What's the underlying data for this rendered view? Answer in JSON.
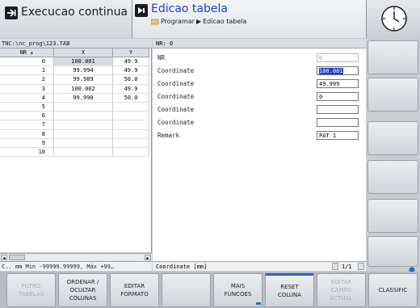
{
  "header": {
    "mode_title": "Execucao continua",
    "sub_title": "Edicao tabela",
    "breadcrumb_a": "Programar",
    "breadcrumb_b": "Edicao tabela",
    "accent": "#1f3fc8"
  },
  "table": {
    "path": "TNC:\\nc_prog\\123.TAB",
    "columns": [
      "NR",
      "X",
      "Y"
    ],
    "rows": [
      {
        "nr": "0",
        "x": "100.001",
        "y": "49.9"
      },
      {
        "nr": "1",
        "x": "99.994",
        "y": "49.9"
      },
      {
        "nr": "2",
        "x": "99.989",
        "y": "50.0"
      },
      {
        "nr": "3",
        "x": "100.002",
        "y": "49.9"
      },
      {
        "nr": "4",
        "x": "99.990",
        "y": "50.0"
      },
      {
        "nr": "5",
        "x": "",
        "y": ""
      },
      {
        "nr": "6",
        "x": "",
        "y": ""
      },
      {
        "nr": "7",
        "x": "",
        "y": ""
      },
      {
        "nr": "8",
        "x": "",
        "y": ""
      },
      {
        "nr": "9",
        "x": "",
        "y": ""
      },
      {
        "nr": "10",
        "x": "",
        "y": ""
      }
    ],
    "status": "C.. mm Min -99999.99999, Máx +99…"
  },
  "form": {
    "header": "NR: 0",
    "fields": [
      {
        "label": "NR",
        "value": "0"
      },
      {
        "label": "Coordinate",
        "value": "100.001"
      },
      {
        "label": "Coordinate",
        "value": "49.999"
      },
      {
        "label": "Coordinate",
        "value": "0"
      },
      {
        "label": "Coordinate",
        "value": ""
      },
      {
        "label": "Coordinate",
        "value": ""
      },
      {
        "label": "Remark",
        "value": "PAT 1"
      }
    ],
    "status": "Coordinate [mm]",
    "page": "1/1"
  },
  "softkeys": [
    {
      "label": "FILTRO\nTABELAS",
      "enabled": false
    },
    {
      "label": "ORDENAR /\nOCULTAR\nCOLUNAS",
      "enabled": true
    },
    {
      "label": "EDITAR\nFORMATO",
      "enabled": true
    },
    {
      "label": "",
      "enabled": true
    },
    {
      "label": "MAIS\nFUNCOES",
      "enabled": true
    },
    {
      "label": "RESET\nCOLUNA",
      "enabled": true
    },
    {
      "label": "EDITAR\nCAMPO\nACTUAL",
      "enabled": false
    },
    {
      "label": "CLASSIFIC",
      "enabled": true
    }
  ],
  "icons": {
    "mode": "program-run-icon",
    "edit": "table-edit-icon",
    "clock": "clock-icon"
  }
}
